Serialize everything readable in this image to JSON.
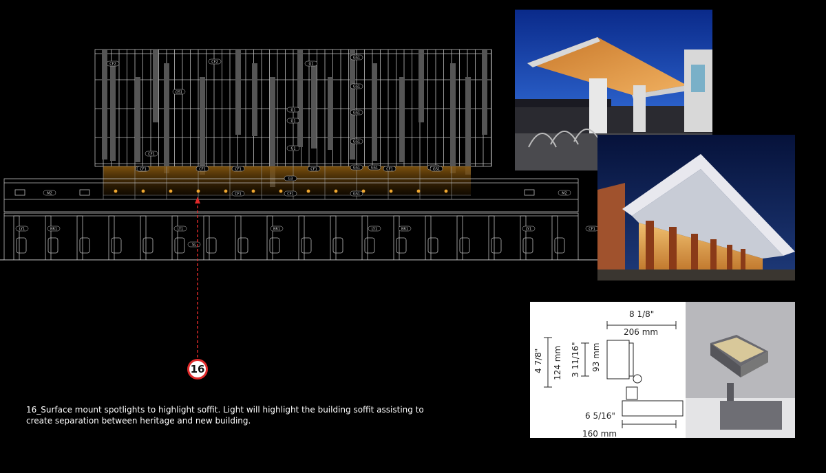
{
  "marker": {
    "number": "16",
    "color": "#e02a2a"
  },
  "caption": {
    "line1": "16_Surface mount spotlights to highlight soffit. Light will highlight the building soffit assisting to",
    "line2": "create separation between heritage and new building."
  },
  "elevation_tags": {
    "upper": [
      "CF2",
      "CF2",
      "G1",
      "GS1",
      "GS1",
      "GS1",
      "GS1",
      "GS1",
      "GS1",
      "GS1",
      "G1",
      "G1",
      "G1",
      "GS1"
    ],
    "soffit": [
      "CF1",
      "CF1",
      "CF1",
      "CF1",
      "CF1",
      "GS1",
      "CF1",
      "CF1",
      "GS1",
      "CF1",
      "CF1",
      "M2",
      "M2",
      "G3"
    ],
    "heritage": [
      "LY1",
      "BR1",
      "LY1",
      "BR1",
      "LY1",
      "BR1",
      "LY1",
      "CF1",
      "SL"
    ]
  },
  "spec": {
    "width_in": "8 1/8\"",
    "width_mm": "206 mm",
    "height_in": "4 7/8\"",
    "height_mm": "124 mm",
    "head_in": "3 11/16\"",
    "head_mm": "93 mm",
    "base_in": "6 5/16\"",
    "base_mm": "160 mm"
  },
  "colors": {
    "background": "#000000",
    "line": "#cfcfcf",
    "light": "#f0a830"
  }
}
